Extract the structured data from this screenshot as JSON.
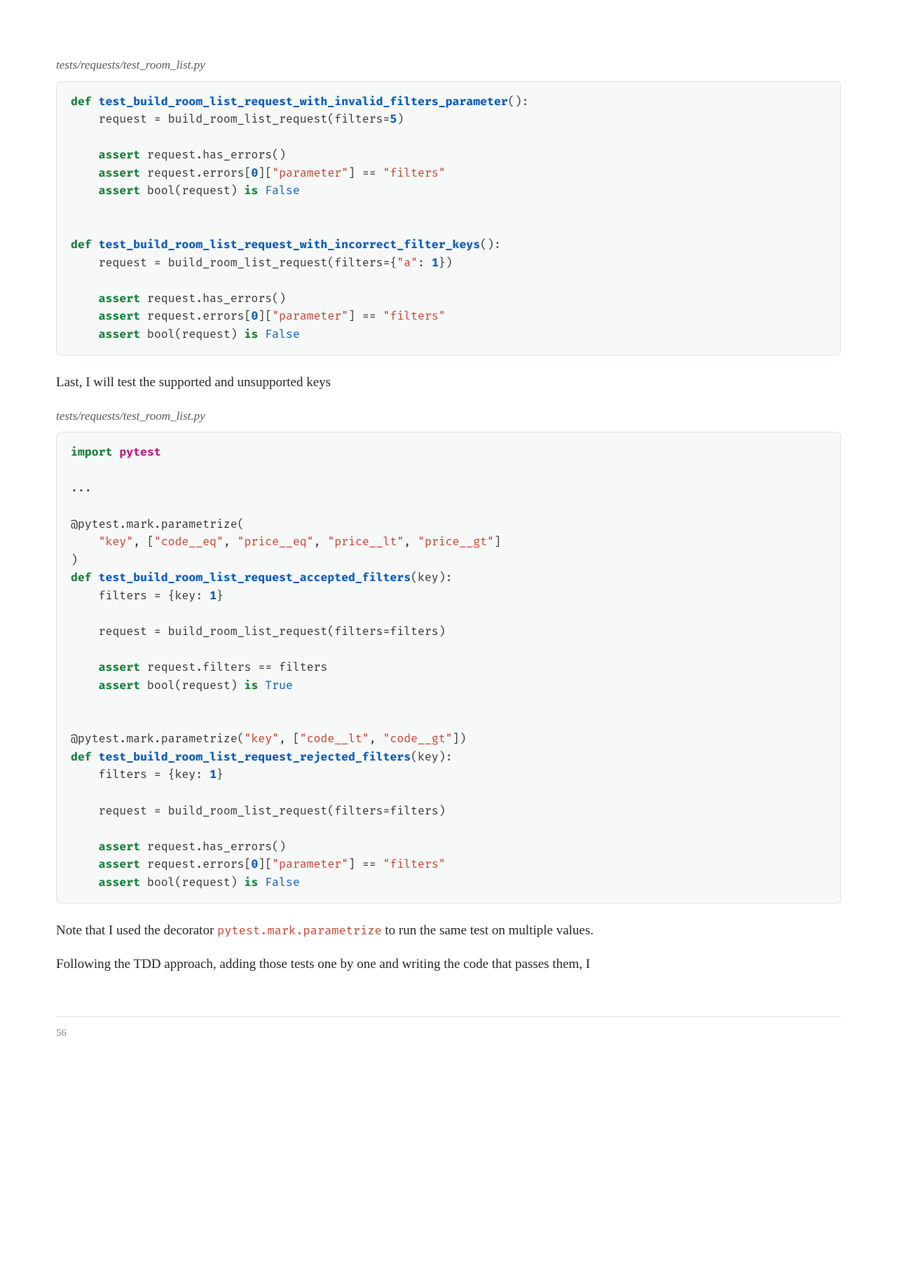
{
  "page_number": "56",
  "caption1": "tests/requests/test_room_list.py",
  "caption2": "tests/requests/test_room_list.py",
  "para1": "Last, I will test the supported and unsupported keys",
  "para2_pre": "Note that I used the decorator ",
  "para2_code": "pytest.mark.parametrize",
  "para2_post": " to run the same test on multiple values.",
  "para3": "Following the TDD approach, adding those tests one by one and writing the code that passes them, I",
  "code1": {
    "tokens": [
      {
        "c": "kw",
        "t": "def"
      },
      {
        "t": " "
      },
      {
        "c": "fn",
        "t": "test_build_room_list_request_with_invalid_filters_parameter"
      },
      {
        "t": "():"
      },
      {
        "br": true
      },
      {
        "t": "    request = build_room_list_request(filters="
      },
      {
        "c": "num",
        "t": "5"
      },
      {
        "t": ")"
      },
      {
        "br": true
      },
      {
        "br": true
      },
      {
        "t": "    "
      },
      {
        "c": "kw",
        "t": "assert"
      },
      {
        "t": " request.has_errors()"
      },
      {
        "br": true
      },
      {
        "t": "    "
      },
      {
        "c": "kw",
        "t": "assert"
      },
      {
        "t": " request.errors["
      },
      {
        "c": "num",
        "t": "0"
      },
      {
        "t": "]["
      },
      {
        "c": "str",
        "t": "\"parameter\""
      },
      {
        "t": "] == "
      },
      {
        "c": "str",
        "t": "\"filters\""
      },
      {
        "br": true
      },
      {
        "t": "    "
      },
      {
        "c": "kw",
        "t": "assert"
      },
      {
        "t": " bool(request) "
      },
      {
        "c": "kw",
        "t": "is"
      },
      {
        "t": " "
      },
      {
        "c": "bool",
        "t": "False"
      },
      {
        "br": true
      },
      {
        "br": true
      },
      {
        "br": true
      },
      {
        "c": "kw",
        "t": "def"
      },
      {
        "t": " "
      },
      {
        "c": "fn",
        "t": "test_build_room_list_request_with_incorrect_filter_keys"
      },
      {
        "t": "():"
      },
      {
        "br": true
      },
      {
        "t": "    request = build_room_list_request(filters={"
      },
      {
        "c": "str",
        "t": "\"a\""
      },
      {
        "t": ": "
      },
      {
        "c": "num",
        "t": "1"
      },
      {
        "t": "})"
      },
      {
        "br": true
      },
      {
        "br": true
      },
      {
        "t": "    "
      },
      {
        "c": "kw",
        "t": "assert"
      },
      {
        "t": " request.has_errors()"
      },
      {
        "br": true
      },
      {
        "t": "    "
      },
      {
        "c": "kw",
        "t": "assert"
      },
      {
        "t": " request.errors["
      },
      {
        "c": "num",
        "t": "0"
      },
      {
        "t": "]["
      },
      {
        "c": "str",
        "t": "\"parameter\""
      },
      {
        "t": "] == "
      },
      {
        "c": "str",
        "t": "\"filters\""
      },
      {
        "br": true
      },
      {
        "t": "    "
      },
      {
        "c": "kw",
        "t": "assert"
      },
      {
        "t": " bool(request) "
      },
      {
        "c": "kw",
        "t": "is"
      },
      {
        "t": " "
      },
      {
        "c": "bool",
        "t": "False"
      }
    ]
  },
  "code2": {
    "tokens": [
      {
        "c": "kw",
        "t": "import"
      },
      {
        "t": " "
      },
      {
        "c": "mod",
        "t": "pytest"
      },
      {
        "br": true
      },
      {
        "br": true
      },
      {
        "t": "..."
      },
      {
        "br": true
      },
      {
        "br": true
      },
      {
        "t": "@pytest.mark.parametrize("
      },
      {
        "br": true
      },
      {
        "t": "    "
      },
      {
        "c": "str",
        "t": "\"key\""
      },
      {
        "t": ", ["
      },
      {
        "c": "str",
        "t": "\"code__eq\""
      },
      {
        "t": ", "
      },
      {
        "c": "str",
        "t": "\"price__eq\""
      },
      {
        "t": ", "
      },
      {
        "c": "str",
        "t": "\"price__lt\""
      },
      {
        "t": ", "
      },
      {
        "c": "str",
        "t": "\"price__gt\""
      },
      {
        "t": "]"
      },
      {
        "br": true
      },
      {
        "t": ")"
      },
      {
        "br": true
      },
      {
        "c": "kw",
        "t": "def"
      },
      {
        "t": " "
      },
      {
        "c": "fn",
        "t": "test_build_room_list_request_accepted_filters"
      },
      {
        "t": "(key):"
      },
      {
        "br": true
      },
      {
        "t": "    filters = {key: "
      },
      {
        "c": "num",
        "t": "1"
      },
      {
        "t": "}"
      },
      {
        "br": true
      },
      {
        "br": true
      },
      {
        "t": "    request = build_room_list_request(filters=filters)"
      },
      {
        "br": true
      },
      {
        "br": true
      },
      {
        "t": "    "
      },
      {
        "c": "kw",
        "t": "assert"
      },
      {
        "t": " request.filters == filters"
      },
      {
        "br": true
      },
      {
        "t": "    "
      },
      {
        "c": "kw",
        "t": "assert"
      },
      {
        "t": " bool(request) "
      },
      {
        "c": "kw",
        "t": "is"
      },
      {
        "t": " "
      },
      {
        "c": "bool",
        "t": "True"
      },
      {
        "br": true
      },
      {
        "br": true
      },
      {
        "br": true
      },
      {
        "t": "@pytest.mark.parametrize("
      },
      {
        "c": "str",
        "t": "\"key\""
      },
      {
        "t": ", ["
      },
      {
        "c": "str",
        "t": "\"code__lt\""
      },
      {
        "t": ", "
      },
      {
        "c": "str",
        "t": "\"code__gt\""
      },
      {
        "t": "])"
      },
      {
        "br": true
      },
      {
        "c": "kw",
        "t": "def"
      },
      {
        "t": " "
      },
      {
        "c": "fn",
        "t": "test_build_room_list_request_rejected_filters"
      },
      {
        "t": "(key):"
      },
      {
        "br": true
      },
      {
        "t": "    filters = {key: "
      },
      {
        "c": "num",
        "t": "1"
      },
      {
        "t": "}"
      },
      {
        "br": true
      },
      {
        "br": true
      },
      {
        "t": "    request = build_room_list_request(filters=filters)"
      },
      {
        "br": true
      },
      {
        "br": true
      },
      {
        "t": "    "
      },
      {
        "c": "kw",
        "t": "assert"
      },
      {
        "t": " request.has_errors()"
      },
      {
        "br": true
      },
      {
        "t": "    "
      },
      {
        "c": "kw",
        "t": "assert"
      },
      {
        "t": " request.errors["
      },
      {
        "c": "num",
        "t": "0"
      },
      {
        "t": "]["
      },
      {
        "c": "str",
        "t": "\"parameter\""
      },
      {
        "t": "] == "
      },
      {
        "c": "str",
        "t": "\"filters\""
      },
      {
        "br": true
      },
      {
        "t": "    "
      },
      {
        "c": "kw",
        "t": "assert"
      },
      {
        "t": " bool(request) "
      },
      {
        "c": "kw",
        "t": "is"
      },
      {
        "t": " "
      },
      {
        "c": "bool",
        "t": "False"
      }
    ]
  }
}
